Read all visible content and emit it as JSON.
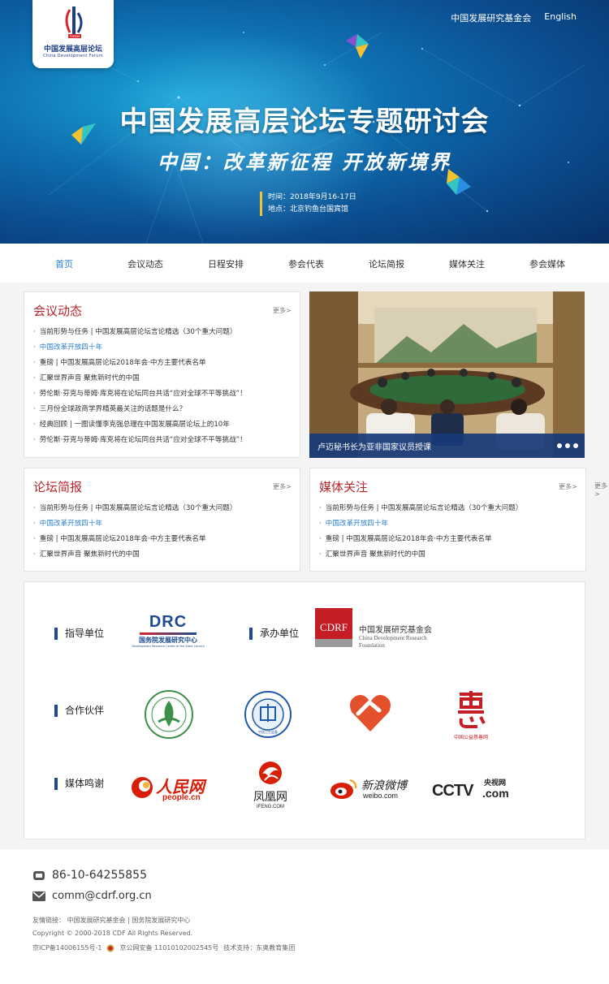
{
  "header": {
    "logo_cn": "中国发展高层论坛",
    "logo_en": "China Development Forum",
    "logo_badge": "FORUM",
    "links": [
      "中国发展研究基金会",
      "English"
    ],
    "title": "中国发展高层论坛专题研讨会",
    "slogan": "中国：改革新征程 开放新境界",
    "time": "时间：2018年9月16-17日",
    "place": "地点：北京钓鱼台国宾馆"
  },
  "nav": [
    "首页",
    "会议动态",
    "日程安排",
    "参会代表",
    "论坛简报",
    "媒体关注",
    "参会媒体"
  ],
  "nav_active_index": 0,
  "news_section": {
    "title": "会议动态",
    "more": "更多>",
    "items": [
      "当前形势与任务 | 中国发展高层论坛言论精选（30个重大问题）",
      "中国改革开放四十年",
      "重磅 | 中国发展高层论坛2018年会·中方主要代表名单",
      "汇聚世界声音 聚焦新时代的中国",
      "劳伦斯·芬克与蒂姆·库克将在论坛同台共话“应对全球不平等挑战”！",
      "三月份全球政商学界精英最关注的话题是什么？",
      "经典回顾 | 一图读懂李克强总理在中国发展高层论坛上的10年",
      "劳伦斯·芬克与蒂姆·库克将在论坛同台共话“应对全球不平等挑战”！"
    ],
    "highlight_index": 1
  },
  "slider": {
    "caption": "卢迈秘书长为亚非国家议员授课",
    "dots": 3
  },
  "briefing": {
    "title": "论坛简报",
    "more": "更多>",
    "items": [
      "当前形势与任务 | 中国发展高层论坛言论精选（30个重大问题）",
      "中国改革开放四十年",
      "重磅 | 中国发展高层论坛2018年会·中方主要代表名单",
      "汇聚世界声音 聚焦新时代的中国"
    ],
    "highlight_index": 1
  },
  "media": {
    "title": "媒体关注",
    "more": "更多>",
    "more_overflow": "更多>",
    "items": [
      "当前形势与任务 | 中国发展高层论坛言论精选（30个重大问题）",
      "中国改革开放四十年",
      "重磅 | 中国发展高层论坛2018年会·中方主要代表名单",
      "汇聚世界声音 聚焦新时代的中国"
    ],
    "highlight_index": 1
  },
  "sponsors": {
    "guide_label": "指导单位",
    "host_label": "承办单位",
    "partner_label": "合作伙伴",
    "media_label": "媒体鸣谢",
    "drc_abbr": "DRC",
    "drc_name": "国务院发展研究中心",
    "drc_en": "Development Research Center of the State Council",
    "cdrf_abbr": "CDRF",
    "cdrf_cn": "中国发展研究基金会",
    "cdrf_en1": "China Development Research",
    "cdrf_en2": "Foundation",
    "health_center": "中国卫生监督",
    "charity_name": "中国公益慈善网",
    "people_cn": "人民网",
    "people_en": "people.cn",
    "ifeng_cn": "凤凰网",
    "ifeng_en": "IFENG.COM",
    "weibo_cn": "新浪微博",
    "weibo_en": "weibo.com",
    "cctv_en": "CCTV",
    "cctv_com": ".com",
    "cctv_cn": "央视网"
  },
  "footer": {
    "phone": "86-10-64255855",
    "email": "comm@cdrf.org.cn",
    "links": "友情链接： 中国发展研究基金会 | 国务院发展研究中心",
    "copyright": "Copyright © 2000-2018 CDF All Rights Reserved.",
    "icp": "京ICP备14006155号-1",
    "police": "京公网安备 11010102002545号",
    "support": "技术支持：东奥教育集团"
  },
  "colors": {
    "accent_red": "#b4272c",
    "link_blue": "#2a7ed2",
    "nav_blue": "#1d4a8f"
  }
}
